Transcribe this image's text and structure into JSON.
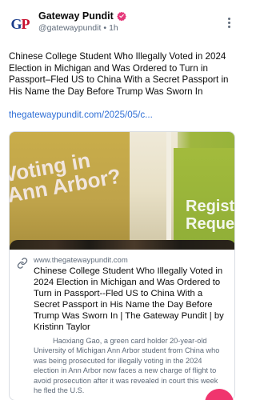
{
  "post": {
    "author_name": "Gateway Pundit",
    "handle": "@gatewaypundit",
    "separator": "•",
    "time": "1h",
    "avatar_letters": {
      "g": "G",
      "p": "P"
    },
    "text": "Chinese College Student Who Illegally Voted in 2024 Election in Michigan and Was Ordered to Turn in Passport–Fled US to China With a Secret Passport in His Name the Day Before Trump Was Sworn In",
    "link": "thegatewaypundit.com/2025/05/c..."
  },
  "card": {
    "domain": "www.thegatewaypundit.com",
    "title": "Chinese College Student Who Illegally Voted in 2024 Election in Michigan and Was Ordered to Turn in Passport--Fled US to China With a Secret Passport in His Name the Day Before Trump Was Sworn In | The Gateway Pundit | by Kristinn Taylor",
    "description": "Haoxiang Gao, a green card holder 20-year-old University of Michigan Ann Arbor student from China who was being prosecuted for illegally voting in the 2024 election in Ann Arbor now faces a new charge of flight to avoid prosecution after it was revealed in court this week he fled the U.S.",
    "image_text_left_1": "Voting in",
    "image_text_left_2": "Ann Arbor?",
    "image_text_right_1": "Register",
    "image_text_right_2": "Request"
  },
  "colors": {
    "link": "#2f6fd6",
    "verified_badge": "#e5397a",
    "fab": "#f0356e"
  },
  "icons": {
    "verified": "verified-badge-icon",
    "more": "more-options-icon",
    "link": "link-icon"
  }
}
